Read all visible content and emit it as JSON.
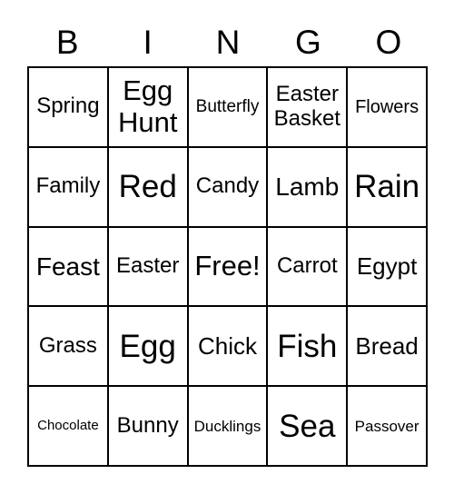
{
  "header": [
    "B",
    "I",
    "N",
    "G",
    "O"
  ],
  "cells": [
    "Spring",
    "Egg Hunt",
    "Butterfly",
    "Easter Basket",
    "Flowers",
    "Family",
    "Red",
    "Candy",
    "Lamb",
    "Rain",
    "Feast",
    "Easter",
    "Free!",
    "Carrot",
    "Egypt",
    "Grass",
    "Egg",
    "Chick",
    "Fish",
    "Bread",
    "Chocolate",
    "Bunny",
    "Ducklings",
    "Sea",
    "Passover"
  ]
}
